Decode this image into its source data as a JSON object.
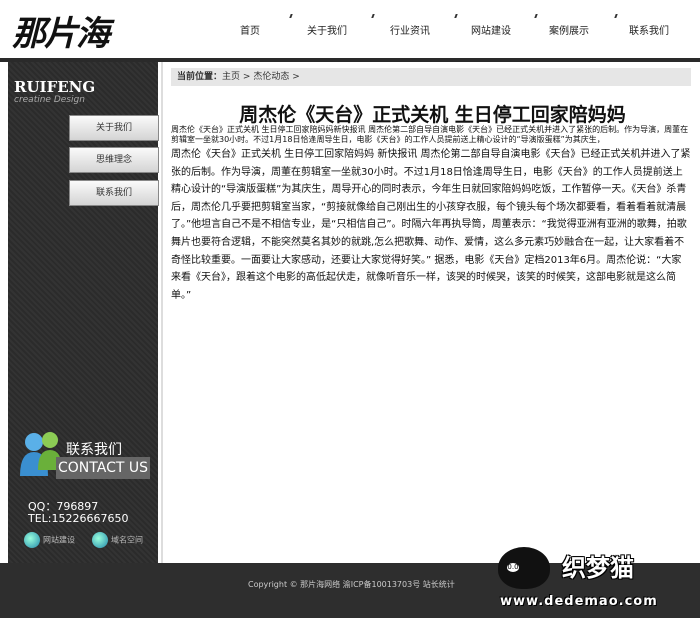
{
  "site": {
    "logo_text": "那片海"
  },
  "nav": [
    "首页",
    "关于我们",
    "行业资讯",
    "网站建设",
    "案例展示",
    "联系我们"
  ],
  "sidebar": {
    "brand": "RUIFENG",
    "brand_sub": "creatine Design",
    "menu": [
      "关于我们",
      "思维理念",
      "联系我们"
    ],
    "contact_cn": "联系我们",
    "contact_en": "CONTACT US",
    "qq": "QQ：796897",
    "tel": "TEL:15226667650",
    "links": [
      "网站建设",
      "域名空间"
    ]
  },
  "breadcrumb": {
    "label": "当前位置：",
    "home": "主页",
    "sep": ">",
    "section": "杰伦动态",
    "end": ">"
  },
  "article": {
    "title": "周杰伦《天台》正式关机 生日停工回家陪妈妈",
    "summary": "周杰伦《天台》正式关机 生日停工回家陪妈妈新快报讯  周杰伦第二部自导自演电影《天台》已经正式关机并进入了紧张的后制。作为导演，周董在剪辑室一坐就30小时。不过1月18日恰逢周导生日，电影《天台》的工作人员提前送上精心设计的“导演版蛋糕”为其庆生，",
    "body": "周杰伦《天台》正式关机 生日停工回家陪妈妈  新快报讯  周杰伦第二部自导自演电影《天台》已经正式关机并进入了紧张的后制。作为导演，周董在剪辑室一坐就30小时。不过1月18日恰逢周导生日，电影《天台》的工作人员提前送上精心设计的“导演版蛋糕”为其庆生，周导开心的同时表示，今年生日就回家陪妈妈吃饭，工作暂停一天。《天台》杀青后，周杰伦几乎要把剪辑室当家，“剪接就像给自己刚出生的小孩穿衣服，每个镜头每个场次都要看，看着看着就清晨了。”他坦言自己不是不相信专业，是“只相信自己”。时隔六年再执导筒，周董表示：“我觉得亚洲有亚洲的歌舞，拍歌舞片也要符合逻辑，不能突然莫名其妙的就跳,怎么把歌舞、动作、爱情，这么多元素巧妙融合在一起，让大家看着不奇怪比较重要。一面要让大家感动，还要让大家觉得好笑。”  据悉，电影《天台》定档2013年6月。周杰伦说：“大家来看《天台》，跟着这个电影的高低起伏走，就像听音乐一样，该哭的时候哭，该笑的时候笑，这部电影就是这么简单。”"
  },
  "footer": {
    "copyright": "Copyright ©  那片海网络    渝ICP备10013703号 站长统计"
  },
  "watermark": {
    "eyes": "0.0",
    "name": "织梦猫",
    "url": "www.dedemao.com"
  }
}
